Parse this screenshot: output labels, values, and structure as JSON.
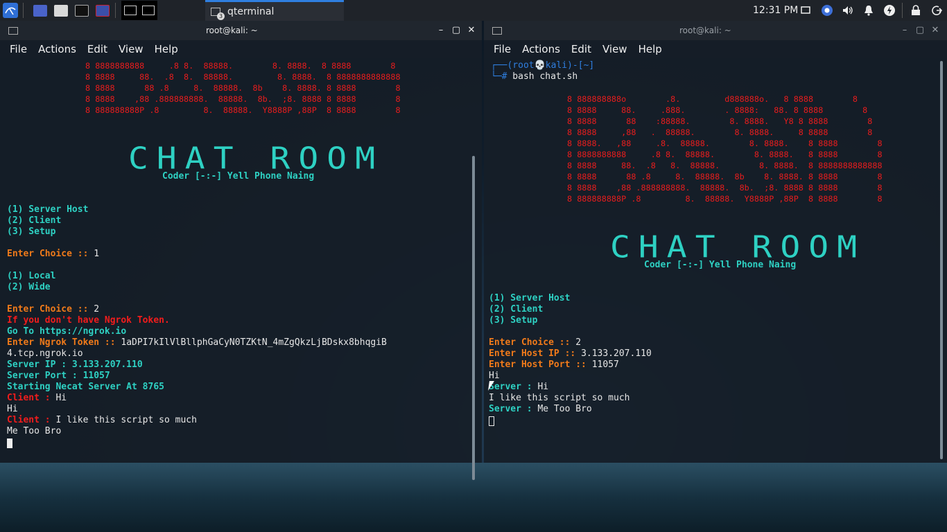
{
  "panel": {
    "clock": "12:31 PM",
    "task_label": "qterminal",
    "task_badge": "3"
  },
  "left_window": {
    "title": "root@kali: ~",
    "menu": [
      "File",
      "Actions",
      "Edit",
      "View",
      "Help"
    ],
    "ascii_lines": [
      "8 8888888888     .8 8.  88888.        8. 8888.  8 8888        8",
      "8 8888     88.  .8  8.  88888.         8. 8888.  8 8888888888888",
      "8 8888      88 .8     8.  88888.  8b    8. 8888. 8 8888        8",
      "8 8888    ,88 .888888888.  88888.  8b.  ;8. 8888 8 8888        8",
      "8 888888888P .8         8.  88888.  Y8888P ,88P  8 8888        8"
    ],
    "big_title": "CHAT ROOM",
    "coder": "Coder [-:-] Yell Phone Naing",
    "menu_options": [
      "(1) Server Host",
      "(2) Client",
      "(3) Setup"
    ],
    "choice_label_1": "Enter Choice :: ",
    "choice_value_1": "1",
    "sub_options": [
      "(1) Local",
      "(2) Wide"
    ],
    "choice_label_2": "Enter Choice :: ",
    "choice_value_2": "2",
    "no_token": "If you don't have Ngrok Token.",
    "goto": "Go To https://ngrok.io",
    "token_label": "Enter Ngrok Token :: ",
    "token_value": "1aDPI7kIlVlBllphGaCyN0TZKtN_4mZgQkzLjBDskx8bhqgiB",
    "ngrok_host": "4.tcp.ngrok.io",
    "server_ip": "Server IP : 3.133.207.110",
    "server_port": "Server Port : 11057",
    "starting": "Starting Necat Server At 8765",
    "client_label": "Client : ",
    "client_msg_1": "Hi",
    "reply_1": "Hi",
    "client_msg_2": "I like this script so much",
    "reply_2": "Me Too Bro"
  },
  "right_window": {
    "title": "root@kali: ~",
    "menu": [
      "File",
      "Actions",
      "Edit",
      "View",
      "Help"
    ],
    "prompt_line_1": "┌──(root💀kali)-[~]",
    "prompt_symbol": "└─#",
    "command": " bash chat.sh",
    "ascii_lines": [
      "8 888888888o        .8.         d888888o.   8 8888        8",
      "8 8888     88.     .888.        . 8888:   88. 8 8888        8",
      "8 8888      88    :88888.        8. 8888.   Y8 8 8888        8",
      "8 8888     ,88   .  88888.        8. 8888.     8 8888        8",
      "8 8888.   ,88     .8.  88888.        8. 8888.    8 8888        8",
      "8 8888888888     .8 8.  88888.        8. 8888.   8 8888        8",
      "8 8888     88.  .8   8.  88888.        8. 8888.  8 8888888888888",
      "8 8888      88 .8     8.  88888.  8b    8. 8888. 8 8888        8",
      "8 8888    ,88 .888888888.  88888.  8b.  ;8. 8888 8 8888        8",
      "8 888888888P .8         8.  88888.  Y8888P ,88P  8 8888        8"
    ],
    "big_title": "CHAT ROOM",
    "coder": "Coder [-:-] Yell Phone Naing",
    "menu_options": [
      "(1) Server Host",
      "(2) Client",
      "(3) Setup"
    ],
    "choice_label": "Enter Choice :: ",
    "choice_value": "2",
    "host_ip_label": "Enter Host IP :: ",
    "host_ip_value": "3.133.207.110",
    "host_port_label": "Enter Host Port :: ",
    "host_port_value": "11057",
    "msg_1": "Hi",
    "server_label": "Server : ",
    "server_msg_1": "Hi",
    "msg_2": "I like this script so much",
    "server_msg_2": "Me Too Bro"
  }
}
